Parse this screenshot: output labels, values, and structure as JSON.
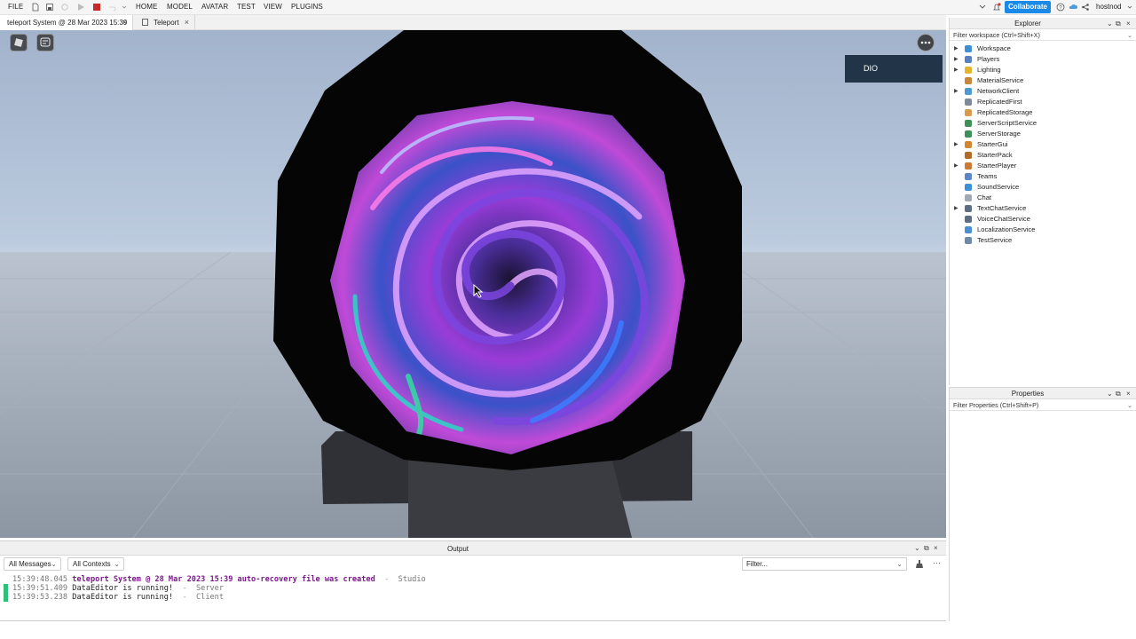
{
  "menubar": {
    "items": [
      "FILE",
      "HOME",
      "MODEL",
      "AVATAR",
      "TEST",
      "VIEW",
      "PLUGINS"
    ],
    "collaborate_label": "Collaborate",
    "username": "hostnod"
  },
  "tabs": [
    {
      "label": "teleport System @ 28 Mar 2023 15:39",
      "active": true
    },
    {
      "label": "Teleport",
      "active": false
    }
  ],
  "viewport": {
    "gui_label": "DIO"
  },
  "output": {
    "title": "Output",
    "messages_filter": "All Messages",
    "contexts_filter": "All Contexts",
    "filter_placeholder": "Filter...",
    "lines": [
      {
        "time": "15:39:48.045",
        "message": "teleport System @ 28 Mar 2023 15:39 auto-recovery file was created",
        "source": "Studio",
        "kind": "warn"
      },
      {
        "time": "15:39:51.409",
        "message": "DataEditor is running!",
        "source": "Server",
        "kind": "info"
      },
      {
        "time": "15:39:53.238",
        "message": "DataEditor is running!",
        "source": "Client",
        "kind": "info"
      }
    ]
  },
  "explorer": {
    "title": "Explorer",
    "filter_placeholder": "Filter workspace (Ctrl+Shift+X)",
    "items": [
      {
        "label": "Workspace",
        "expandable": true,
        "icon": "globe-icon",
        "color": "#3d8fd6"
      },
      {
        "label": "Players",
        "expandable": true,
        "icon": "players-icon",
        "color": "#5a7fc2"
      },
      {
        "label": "Lighting",
        "expandable": true,
        "icon": "lightbulb-icon",
        "color": "#e6b42c"
      },
      {
        "label": "MaterialService",
        "expandable": false,
        "icon": "material-icon",
        "color": "#c9853a"
      },
      {
        "label": "NetworkClient",
        "expandable": true,
        "icon": "network-icon",
        "color": "#4b9bd1"
      },
      {
        "label": "ReplicatedFirst",
        "expandable": false,
        "icon": "replicated-first-icon",
        "color": "#7e8a99"
      },
      {
        "label": "ReplicatedStorage",
        "expandable": false,
        "icon": "replicated-storage-icon",
        "color": "#d99a4b"
      },
      {
        "label": "ServerScriptService",
        "expandable": false,
        "icon": "server-script-icon",
        "color": "#3f8f5a"
      },
      {
        "label": "ServerStorage",
        "expandable": false,
        "icon": "server-storage-icon",
        "color": "#3f8f5a"
      },
      {
        "label": "StarterGui",
        "expandable": true,
        "icon": "starter-gui-icon",
        "color": "#d0872f"
      },
      {
        "label": "StarterPack",
        "expandable": false,
        "icon": "starter-pack-icon",
        "color": "#b36b2a"
      },
      {
        "label": "StarterPlayer",
        "expandable": true,
        "icon": "starter-player-icon",
        "color": "#c97a33"
      },
      {
        "label": "Teams",
        "expandable": false,
        "icon": "teams-icon",
        "color": "#5a87c8"
      },
      {
        "label": "SoundService",
        "expandable": false,
        "icon": "sound-icon",
        "color": "#3d8fd6"
      },
      {
        "label": "Chat",
        "expandable": false,
        "icon": "chat-icon",
        "color": "#a0a8b4"
      },
      {
        "label": "TextChatService",
        "expandable": true,
        "icon": "text-chat-icon",
        "color": "#5d6d82"
      },
      {
        "label": "VoiceChatService",
        "expandable": false,
        "icon": "voice-chat-icon",
        "color": "#5d6d82"
      },
      {
        "label": "LocalizationService",
        "expandable": false,
        "icon": "localization-icon",
        "color": "#4a8fd0"
      },
      {
        "label": "TestService",
        "expandable": false,
        "icon": "test-icon",
        "color": "#6d8aa8"
      }
    ]
  },
  "properties": {
    "title": "Properties",
    "filter_placeholder": "Filter Properties (Ctrl+Shift+P)"
  }
}
